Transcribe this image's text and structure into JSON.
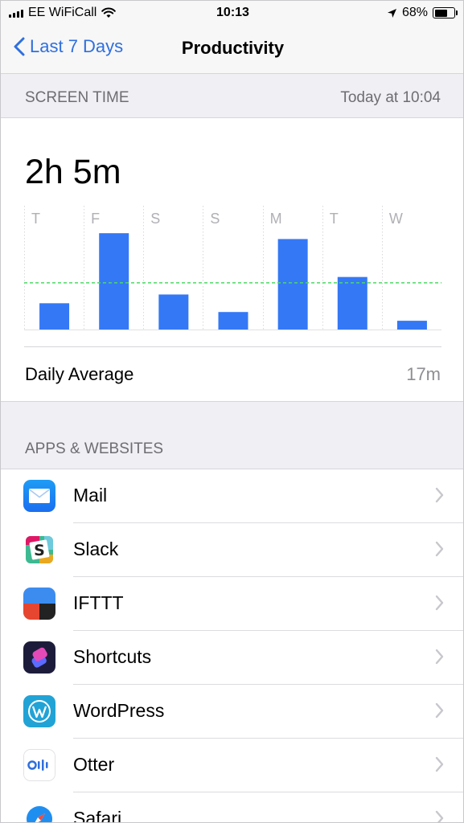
{
  "status_bar": {
    "carrier": "EE WiFiCall",
    "time": "10:13",
    "battery": "68%",
    "battery_level": 0.68
  },
  "nav": {
    "back_label": "Last 7 Days",
    "title": "Productivity"
  },
  "screen_time": {
    "header": "SCREEN TIME",
    "updated": "Today at 10:04",
    "total": "2h 5m",
    "average_label": "Daily Average",
    "average_value": "17m"
  },
  "chart_data": {
    "type": "bar",
    "categories": [
      "T",
      "F",
      "S",
      "S",
      "M",
      "T",
      "W"
    ],
    "values": [
      9,
      33,
      12,
      6,
      31,
      18,
      3
    ],
    "average_line": 16,
    "ylim": [
      0,
      38
    ],
    "bar_color": "#3478f6",
    "average_line_color": "#4cd964"
  },
  "apps_header": "APPS & WEBSITES",
  "apps": [
    {
      "name": "Mail",
      "icon": "mail-icon"
    },
    {
      "name": "Slack",
      "icon": "slack-icon"
    },
    {
      "name": "IFTTT",
      "icon": "ifttt-icon"
    },
    {
      "name": "Shortcuts",
      "icon": "shortcuts-icon"
    },
    {
      "name": "WordPress",
      "icon": "wordpress-icon"
    },
    {
      "name": "Otter",
      "icon": "otter-icon"
    },
    {
      "name": "Safari",
      "icon": "safari-icon"
    }
  ],
  "colors": {
    "accent": "#2f6fde",
    "secondary_text": "#8e8e93",
    "background": "#efeff4"
  }
}
